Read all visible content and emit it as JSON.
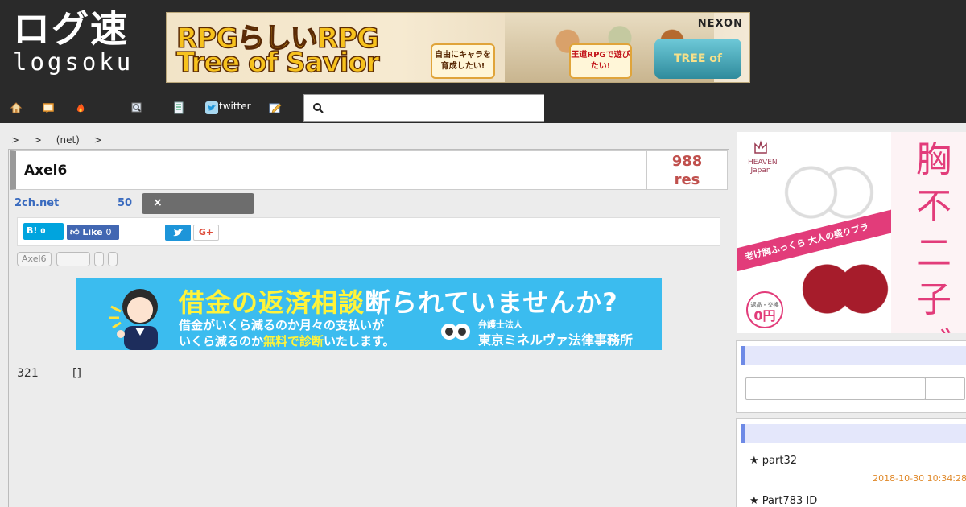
{
  "header": {
    "logo_kanji": "ログ速",
    "logo_roman": "logsoku",
    "banner": {
      "line1": "RPGらしいRPG",
      "line2": "Tree of Savior",
      "bubble1": "自由にキャラを育成したい!",
      "bubble2": "王道RPGで遊びたい!",
      "publisher": "NEXON",
      "game_logo": "TREE of SAVIOR"
    }
  },
  "nav": {
    "twitter_label": "twitter",
    "search_value": "",
    "icons": [
      "home-icon",
      "board-icon",
      "fire-icon",
      "search-icon",
      "list-icon",
      "twitter-icon",
      "edit-icon"
    ]
  },
  "breadcrumb": {
    "sep1": ">",
    "sep2": ">",
    "net": "(net)",
    "sep3": ">"
  },
  "thread": {
    "title": "Axel6",
    "res_count": "988",
    "res_label": "res",
    "source": "2ch.net",
    "count": "50",
    "close_label": "×",
    "share": {
      "hatena": "B!",
      "hatena_count": "0",
      "fb_label": "Like",
      "fb_count": "0",
      "gplus": "G+"
    },
    "tags": [
      "Axel6",
      "",
      "",
      ""
    ],
    "post_number": "321",
    "post_text": "[]"
  },
  "ad_banner": {
    "headline_hl": "借金の返済相談",
    "headline": "断られていませんか?",
    "sub1": "借金がいくら減るのか月々の支払いが",
    "sub2_pre": "いくら減るのか",
    "sub2_hl": "無料で診断",
    "sub2_post": "いたします。",
    "firm_small": "弁護士法人",
    "firm": "東京ミネルヴァ法律事務所"
  },
  "side_ad": {
    "brand": "HEAVEN Japan",
    "band": "老け胸ふっくら 大人の盛りブラ",
    "price_small": "返品・交換",
    "price": "0円",
    "vertical": "胸不二子ブラ"
  },
  "sidebar": {
    "search_value": "",
    "ranking": [
      {
        "title": "★ part32",
        "date": "2018-10-30 10:34:28"
      },
      {
        "title": "★ Part783 ID",
        "date": ""
      }
    ]
  },
  "colors": {
    "header_bg": "#2a2a2a",
    "res_color": "#c0504d",
    "link_blue": "#3a6bbf",
    "ad_blue": "#3bbcef",
    "panel_accent": "#6e8ae6",
    "date_orange": "#e08a2c"
  }
}
